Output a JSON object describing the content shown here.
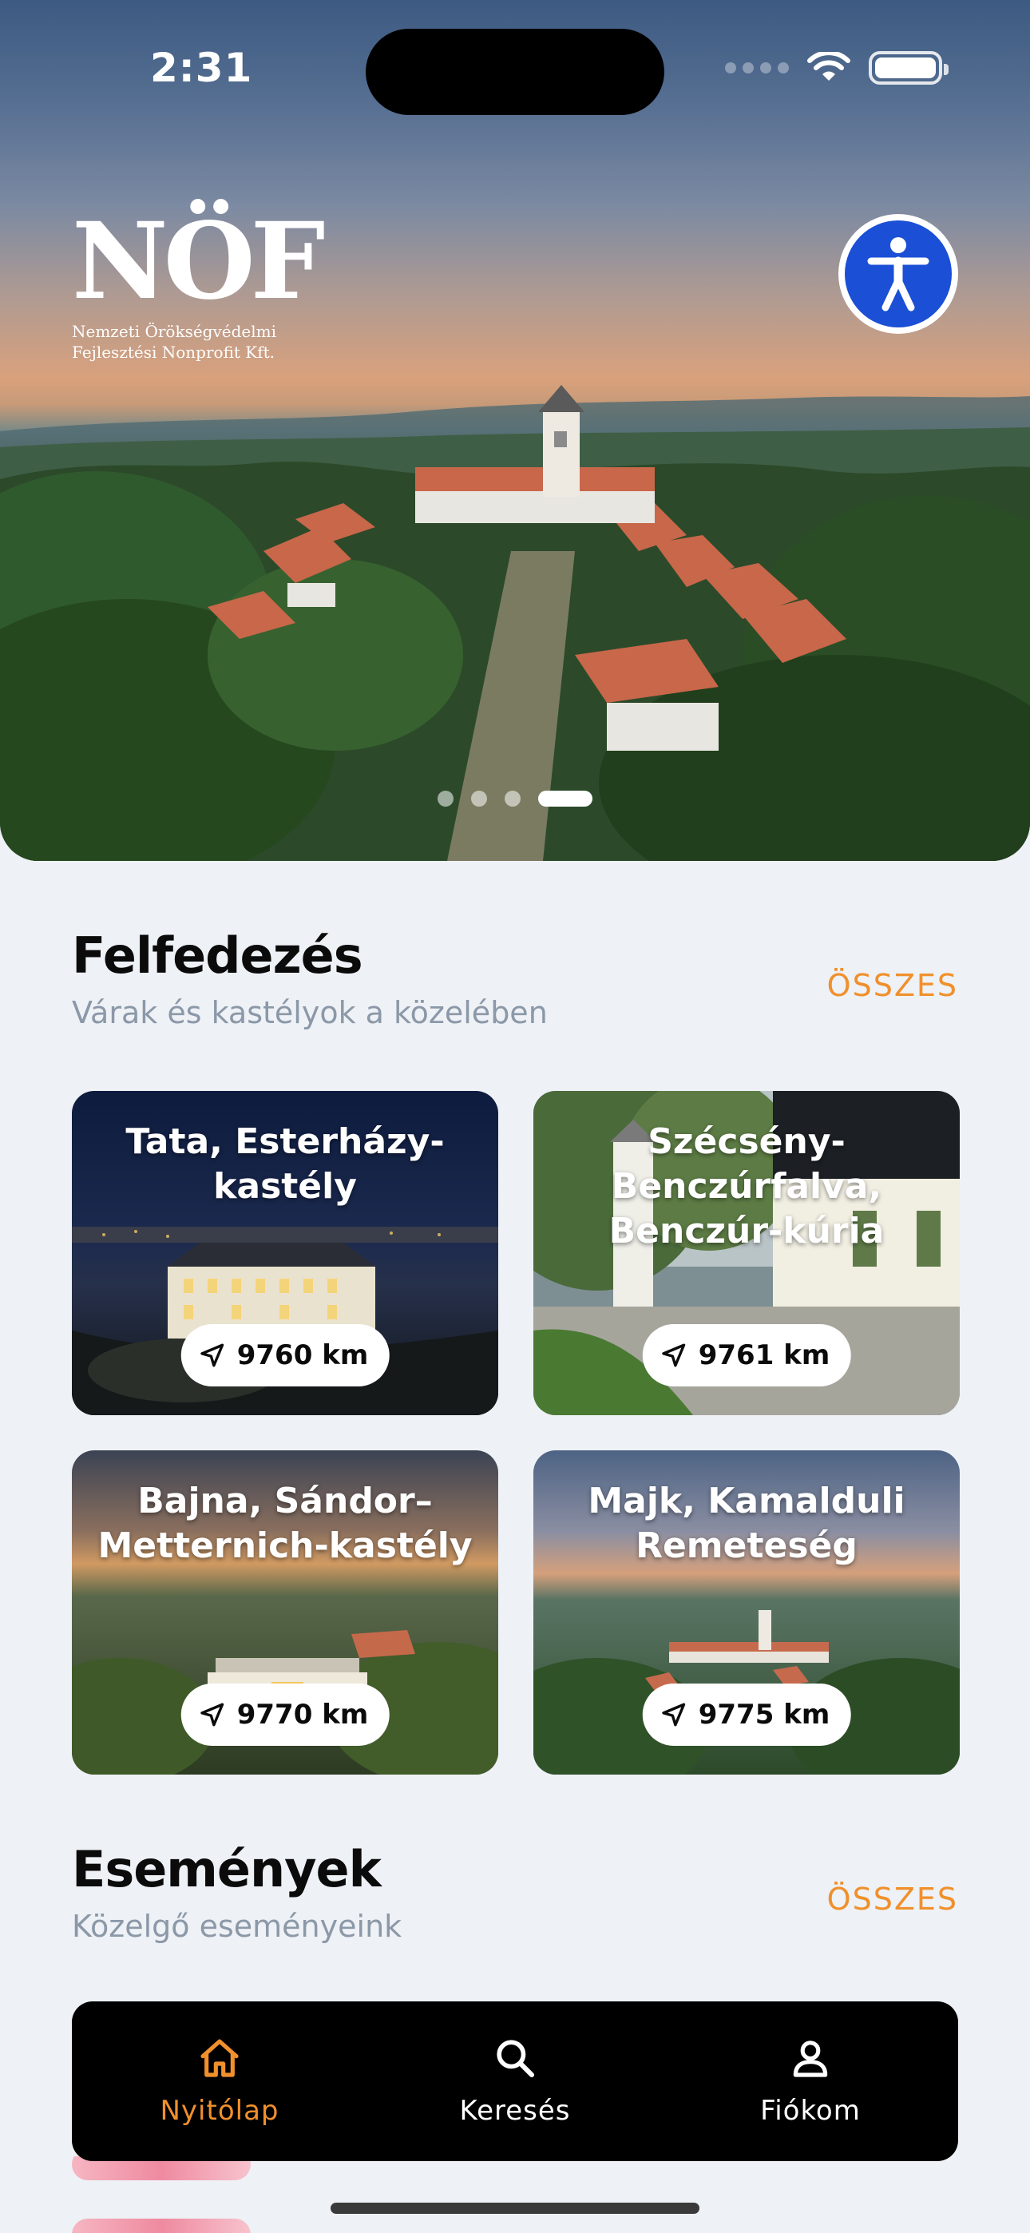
{
  "status_bar": {
    "time": "2:31"
  },
  "hero": {
    "logo_mark": "NÖF",
    "logo_line1": "Nemzeti Örökségvédelmi",
    "logo_line2": "Fejlesztési Nonprofit Kft.",
    "carousel_count": 4,
    "carousel_active": 4
  },
  "explore": {
    "title": "Felfedezés",
    "subtitle": "Várak és kastélyok a közelében",
    "see_all": "ÖSSZES",
    "cards": [
      {
        "title": "Tata, Esterházy-kastély",
        "distance": "9760 km"
      },
      {
        "title": "Szécsény-Benczúrfalva, Benczúr-kúria",
        "distance": "9761 km"
      },
      {
        "title": "Bajna, Sándor–Metternich-kastély",
        "distance": "9770 km"
      },
      {
        "title": "Majk, Kamalduli Remeteség",
        "distance": "9775 km"
      }
    ]
  },
  "events": {
    "title": "Események",
    "subtitle": "Közelgő eseményeink",
    "see_all": "ÖSSZES"
  },
  "tabbar": {
    "items": [
      {
        "label": "Nyitólap",
        "icon": "home-icon",
        "active": true
      },
      {
        "label": "Keresés",
        "icon": "search-icon",
        "active": false
      },
      {
        "label": "Fiókom",
        "icon": "user-icon",
        "active": false
      }
    ]
  },
  "colors": {
    "accent": "#f0902c",
    "background": "#eef1f5",
    "accessibility_blue": "#1a4fd6",
    "tabbar": "#000000"
  }
}
